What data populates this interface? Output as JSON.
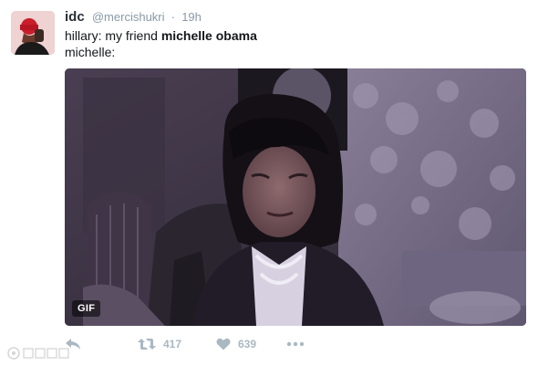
{
  "tweet": {
    "author": {
      "display_name": "idc",
      "handle": "@mercishukri",
      "separator": "·",
      "time": "19h"
    },
    "text": {
      "line1_prefix": "hillary: my friend ",
      "line1_bold": "michelle obama",
      "line2": "michelle:"
    },
    "media": {
      "badge": "GIF"
    },
    "actions": {
      "reply_icon": "reply-icon",
      "retweet_icon": "retweet-icon",
      "retweet_count": "417",
      "like_icon": "heart-icon",
      "like_count": "639",
      "more_icon": "more-icon"
    }
  },
  "colors": {
    "icon_gray": "#aab8c2",
    "meta_gray": "#8899a6",
    "text": "#14171a"
  }
}
